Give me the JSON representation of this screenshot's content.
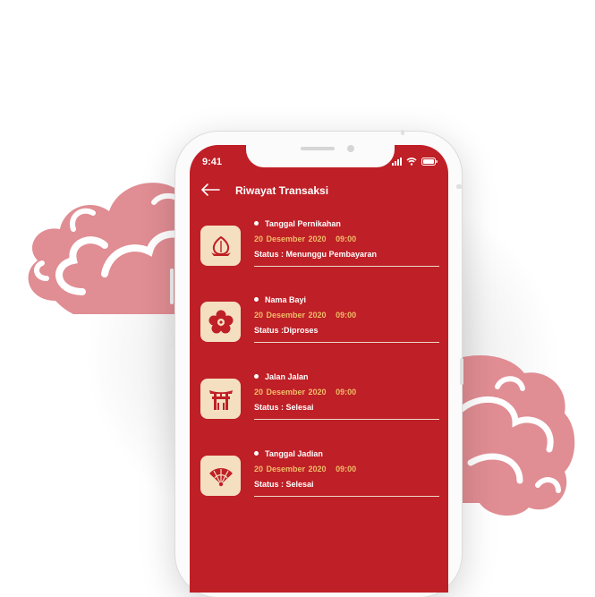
{
  "status_bar": {
    "time": "9:41"
  },
  "header": {
    "title": "Riwayat Transaksi"
  },
  "transactions": [
    {
      "name": "Tanggal Pernikahan",
      "date": "20 Desember 2020",
      "time": "09:00",
      "status": "Status : Menunggu Pembayaran",
      "icon": "peach-icon"
    },
    {
      "name": "Nama Bayi",
      "date": "20 Desember 2020",
      "time": "09:00",
      "status": "Status :Diproses",
      "icon": "plum-flower-icon"
    },
    {
      "name": "Jalan Jalan",
      "date": "20 Desember 2020",
      "time": "09:00",
      "status": "Status : Selesai",
      "icon": "torii-gate-icon"
    },
    {
      "name": "Tanggal Jadian",
      "date": "20 Desember 2020",
      "time": "09:00",
      "status": "Status : Selesai",
      "icon": "folding-fan-icon"
    }
  ],
  "colors": {
    "screen": "#bf1f26",
    "tile": "#f4dfc1",
    "date": "#f0bc6a",
    "cloud": "#e08d93",
    "icon": "#bf1f26"
  }
}
